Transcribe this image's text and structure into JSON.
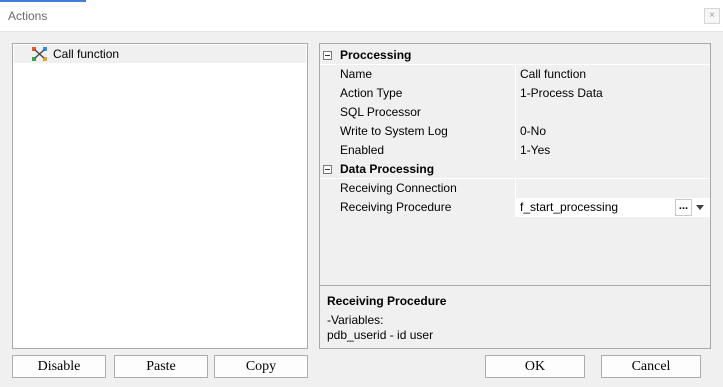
{
  "window": {
    "title": "Actions",
    "close_glyph": "×"
  },
  "tree": {
    "items": [
      {
        "label": "Call function",
        "icon": "function-node-icon"
      }
    ]
  },
  "properties": {
    "categories": [
      {
        "label": "Proccessing",
        "rows": [
          {
            "name": "Name",
            "value": "Call function"
          },
          {
            "name": "Action Type",
            "value": "1-Process Data"
          },
          {
            "name": "SQL Processor",
            "value": ""
          },
          {
            "name": "Write to System Log",
            "value": "0-No"
          },
          {
            "name": "Enabled",
            "value": "1-Yes"
          }
        ]
      },
      {
        "label": "Data Processing",
        "rows": [
          {
            "name": "Receiving Connection",
            "value": ""
          },
          {
            "name": "Receiving Procedure",
            "value": "f_start_processing"
          }
        ]
      }
    ],
    "ellipsis_label": "...",
    "description": {
      "title": "Receiving Procedure",
      "line1": "-Variables:",
      "line2": "pdb_userid - id user"
    }
  },
  "buttons": {
    "disable": "Disable",
    "paste": "Paste",
    "copy": "Copy",
    "ok": "OK",
    "cancel": "Cancel"
  },
  "colors": {
    "accent": "#3e7fd6",
    "window_bg": "#f0f0f0",
    "border": "#a9a9a9"
  }
}
